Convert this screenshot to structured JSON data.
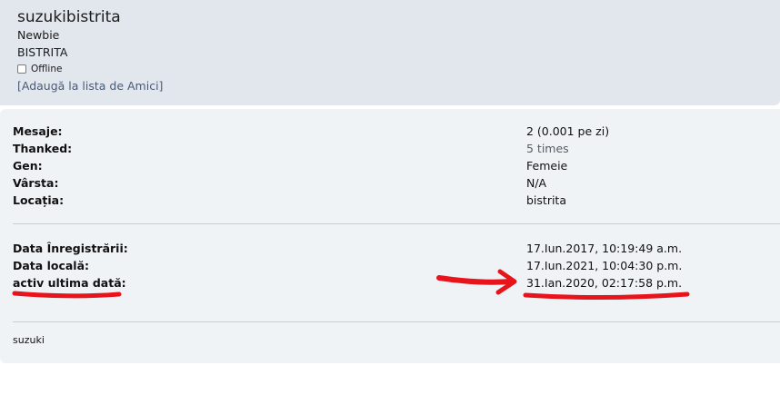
{
  "profile": {
    "username": "suzukibistrita",
    "rank": "Newbie",
    "location_header": "BISTRITA",
    "status": "Offline",
    "add_friend": "[Adaugă la lista de Amici]"
  },
  "stats": [
    {
      "label": "Mesaje:",
      "value": "2 (0.001 pe zi)"
    },
    {
      "label": "Thanked:",
      "value": "5 times"
    },
    {
      "label": "Gen:",
      "value": "Femeie"
    },
    {
      "label": "Vârsta:",
      "value": "N/A"
    },
    {
      "label": "Locația:",
      "value": "bistrita"
    }
  ],
  "dates": [
    {
      "label": "Data Înregistrării:",
      "value": "17.Iun.2017, 10:19:49 a.m."
    },
    {
      "label": "Data locală:",
      "value": "17.Iun.2021, 10:04:30 p.m."
    },
    {
      "label": "activ ultima dată:",
      "value": "31.Ian.2020, 02:17:58 p.m."
    }
  ],
  "signature": "suzuki",
  "colors": {
    "header_bg": "#e2e7ee",
    "panel_bg": "#f0f3f6",
    "annotation": "#e8141b",
    "link": "#4a5a74"
  }
}
